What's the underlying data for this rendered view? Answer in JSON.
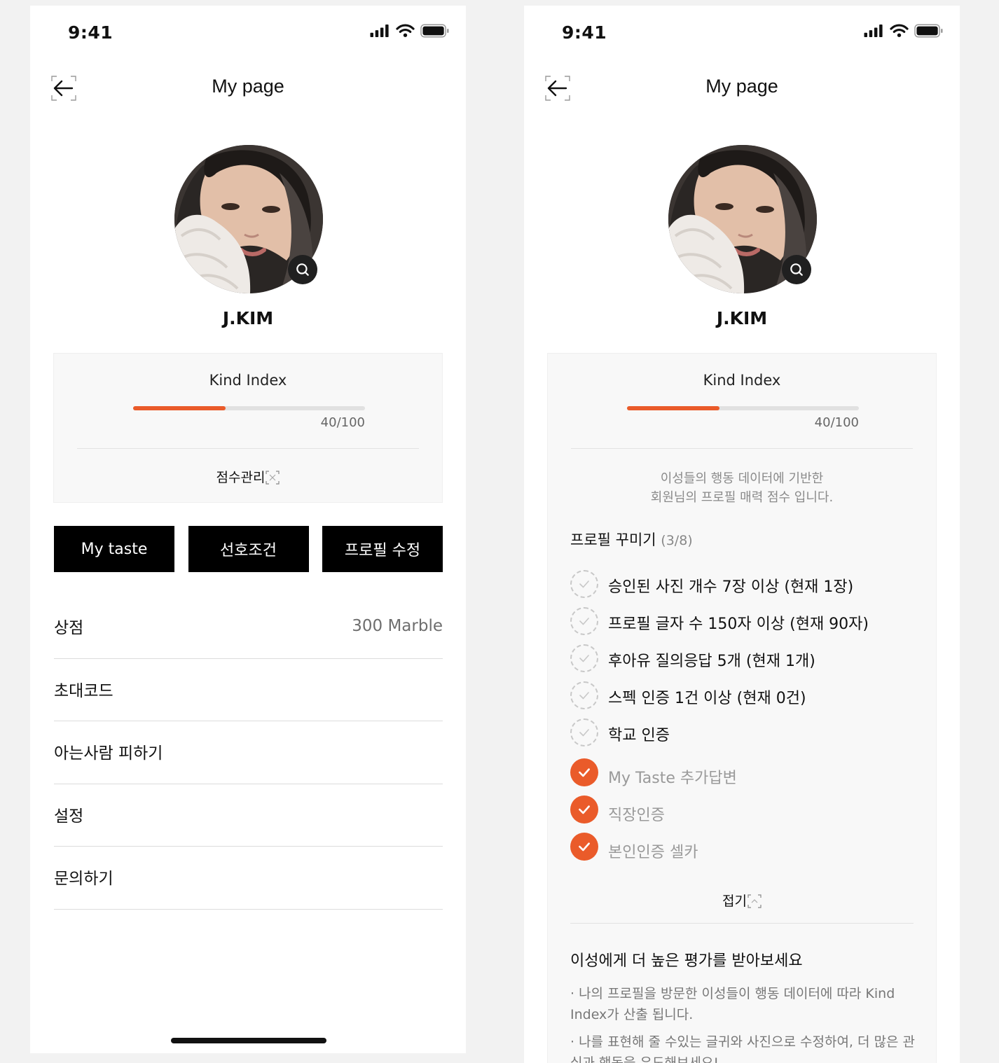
{
  "left": {
    "status": {
      "time": "9:41"
    },
    "nav": {
      "title": "My page"
    },
    "profile": {
      "name": "J.KIM"
    },
    "kind_index": {
      "title": "Kind Index",
      "score_text": "40/100",
      "progress": 0.4,
      "manage_label": "점수관리"
    },
    "buttons": [
      "My taste",
      "선호조건",
      "프로필 수정"
    ],
    "menu": [
      {
        "label": "상점",
        "value": "300 Marble"
      },
      {
        "label": "초대코드",
        "value": ""
      },
      {
        "label": "아는사람 피하기",
        "value": ""
      },
      {
        "label": "설정",
        "value": ""
      },
      {
        "label": "문의하기",
        "value": ""
      }
    ]
  },
  "right": {
    "status": {
      "time": "9:41"
    },
    "nav": {
      "title": "My page"
    },
    "profile": {
      "name": "J.KIM"
    },
    "kind_index": {
      "title": "Kind Index",
      "score_text": "40/100",
      "progress": 0.4
    },
    "description": {
      "line1": "이성들의 행동 데이터에 기반한",
      "line2": "회원님의 프로필 매력 점수 입니다."
    },
    "section": {
      "title": "프로필 꾸미기",
      "count": "(3/8)"
    },
    "checklist": [
      {
        "text": "승인된 사진 개수 7장 이상 (현재 1장)",
        "done": false
      },
      {
        "text": "프로필 글자 수 150자 이상 (현재 90자)",
        "done": false
      },
      {
        "text": "후아유 질의응답 5개 (현재 1개)",
        "done": false
      },
      {
        "text": "스펙 인증 1건 이상 (현재 0건)",
        "done": false
      },
      {
        "text": "학교 인증",
        "done": false
      },
      {
        "text": "My Taste 추가답변",
        "done": true
      },
      {
        "text": "직장인증",
        "done": true
      },
      {
        "text": "본인인증 셀카",
        "done": true
      }
    ],
    "collapse_label": "접기",
    "higher": {
      "title": "이성에게 더 높은 평가를 받아보세요",
      "bullet1": "· 나의 프로필을 방문한 이성들이 행동 데이터에 따라 Kind Index가 산출 됩니다.",
      "bullet2": "· 나를 표현해 줄 수있는 글귀와 사진으로 수정하여, 더 많은 관심과 행동을 유도해보세요!"
    }
  },
  "colors": {
    "accent": "#ea5b2a",
    "button_bg": "#000000",
    "card_bg": "#f8f8f8"
  },
  "icons": [
    "back-arrow-icon",
    "search-icon",
    "signal-icon",
    "wifi-icon",
    "battery-icon",
    "expand-icon",
    "collapse-icon",
    "check-icon"
  ]
}
